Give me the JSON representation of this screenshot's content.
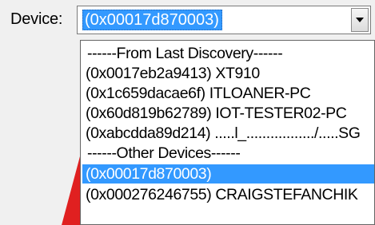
{
  "device_field": {
    "label": "Device:",
    "selected_value": "(0x00017d870003)"
  },
  "dropdown": {
    "options": [
      {
        "label": "------From Last Discovery------",
        "kind": "header"
      },
      {
        "label": "(0x0017eb2a9413) XT910",
        "kind": "device"
      },
      {
        "label": "(0x1c659dacae6f) ITLOANER-PC",
        "kind": "device"
      },
      {
        "label": "(0x60d819b62789) IOT-TESTER02-PC",
        "kind": "device"
      },
      {
        "label": "(0xabcdda89d214) .....l_................./.....SG",
        "kind": "device"
      },
      {
        "label": "------Other Devices------",
        "kind": "header"
      },
      {
        "label": "(0x00017d870003)",
        "kind": "device",
        "selected": true
      },
      {
        "label": "(0x000276246755) CRAIGSTEFANCHIK",
        "kind": "device"
      }
    ]
  },
  "icons": {
    "dropdown_arrow": "chevron-down-icon",
    "warning_shape": "red-triangle-shape"
  },
  "colors": {
    "selection": "#3399ff",
    "selection_text": "#ffffff",
    "warning_red": "#e02020"
  }
}
